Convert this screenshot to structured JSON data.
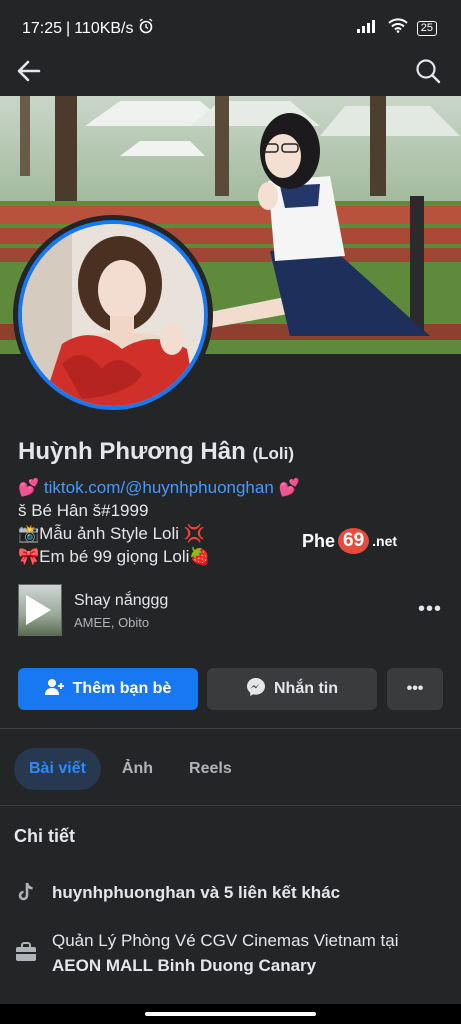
{
  "status_bar": {
    "time": "17:25",
    "network_speed": "110KB/s",
    "battery": "25"
  },
  "profile": {
    "name": "Huỳnh Phương Hân",
    "nickname": "(Loli)",
    "bio": {
      "link_prefix": "💕 ",
      "link": "tiktok.com/@huynhphuonghan",
      "link_suffix": " 💕",
      "line2": "š Bé Hân š#1999",
      "line3": "📸Mẫu ảnh Style Loli 💢",
      "line4": "🎀Em bé 99 giọng Loli🍓"
    },
    "watermark": {
      "left": "Phe",
      "num": "69",
      "right": ".net"
    }
  },
  "music": {
    "title": "Shay nắnggg",
    "artist": "AMEE, Obito",
    "more": "•••"
  },
  "actions": {
    "add_friend": "Thêm bạn bè",
    "message": "Nhắn tin",
    "more": "•••"
  },
  "tabs": [
    {
      "label": "Bài viết",
      "active": true
    },
    {
      "label": "Ảnh",
      "active": false
    },
    {
      "label": "Reels",
      "active": false
    }
  ],
  "details": {
    "title": "Chi tiết",
    "tiktok": {
      "icon": "tiktok-icon",
      "text": "huynhphuonghan và 5 liên kết khác"
    },
    "work": {
      "icon": "briefcase-icon",
      "prefix": "Quản Lý Phòng Vé CGV Cinemas Vietnam tại ",
      "place": "AEON MALL Binh Duong Canary"
    }
  },
  "colors": {
    "background": "#242526",
    "accent": "#1877f2",
    "link": "#4599ff",
    "tab_active_bg": "#263951",
    "secondary_button": "#3a3b3c"
  }
}
